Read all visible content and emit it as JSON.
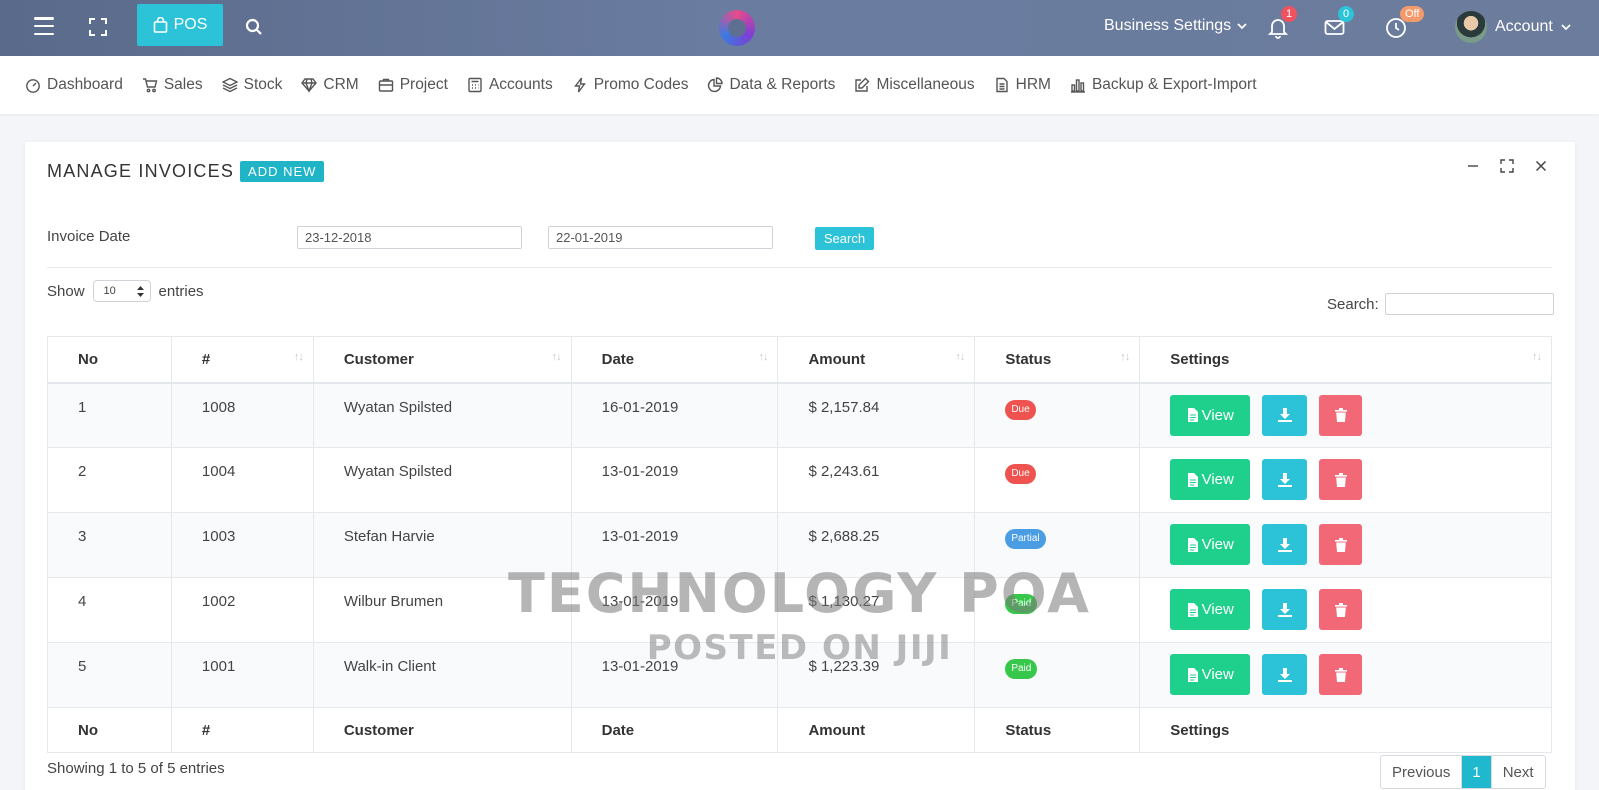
{
  "topbar": {
    "pos_label": "POS",
    "business_settings": "Business Settings",
    "notifications_count": "1",
    "messages_count": "0",
    "clock_badge": "Off",
    "account_label": "Account",
    "colors": {
      "bar": "#5e6f92",
      "pos": "#2cc3d8",
      "notif_badge": "#f0525f",
      "msg_badge": "#2cc3d8",
      "clock_badge": "#f29a6b"
    }
  },
  "nav": [
    {
      "label": "Dashboard",
      "icon": "dashboard-icon"
    },
    {
      "label": "Sales",
      "icon": "cart-icon"
    },
    {
      "label": "Stock",
      "icon": "layers-icon"
    },
    {
      "label": "CRM",
      "icon": "diamond-icon"
    },
    {
      "label": "Project",
      "icon": "briefcase-icon"
    },
    {
      "label": "Accounts",
      "icon": "calculator-icon"
    },
    {
      "label": "Promo Codes",
      "icon": "bolt-icon"
    },
    {
      "label": "Data & Reports",
      "icon": "pie-chart-icon"
    },
    {
      "label": "Miscellaneous",
      "icon": "edit-icon"
    },
    {
      "label": "HRM",
      "icon": "document-icon"
    },
    {
      "label": "Backup & Export-Import",
      "icon": "bar-chart-icon"
    }
  ],
  "card": {
    "title": "MANAGE INVOICES",
    "add_new": "ADD NEW"
  },
  "filter": {
    "label": "Invoice Date",
    "from": "23-12-2018",
    "to": "22-01-2019",
    "search_label": "Search"
  },
  "table_controls": {
    "show_label": "Show",
    "entries_value": "10",
    "entries_label": "entries",
    "search_label": "Search:"
  },
  "table": {
    "columns": [
      "No",
      "#",
      "Customer",
      "Date",
      "Amount",
      "Status",
      "Settings"
    ],
    "rows": [
      {
        "no": "1",
        "id": "1008",
        "customer": "Wyatan Spilsted",
        "date": "16-01-2019",
        "amount": "$ 2,157.84",
        "status": "Due"
      },
      {
        "no": "2",
        "id": "1004",
        "customer": "Wyatan Spilsted",
        "date": "13-01-2019",
        "amount": "$ 2,243.61",
        "status": "Due"
      },
      {
        "no": "3",
        "id": "1003",
        "customer": "Stefan Harvie",
        "date": "13-01-2019",
        "amount": "$ 2,688.25",
        "status": "Partial"
      },
      {
        "no": "4",
        "id": "1002",
        "customer": "Wilbur Brumen",
        "date": "13-01-2019",
        "amount": "$ 1,130.27",
        "status": "Paid"
      },
      {
        "no": "5",
        "id": "1001",
        "customer": "Walk-in Client",
        "date": "13-01-2019",
        "amount": "$ 1,223.39",
        "status": "Paid"
      }
    ],
    "view_label": "View",
    "status_colors": {
      "Due": "#ef5350",
      "Partial": "#4a9de2",
      "Paid": "#37c74a"
    }
  },
  "footer": {
    "info": "Showing 1 to 5 of 5 entries",
    "previous": "Previous",
    "current_page": "1",
    "next": "Next"
  },
  "watermark": {
    "line1": "TECHNOLOGY POA",
    "line2": "POSTED ON JIJI"
  }
}
